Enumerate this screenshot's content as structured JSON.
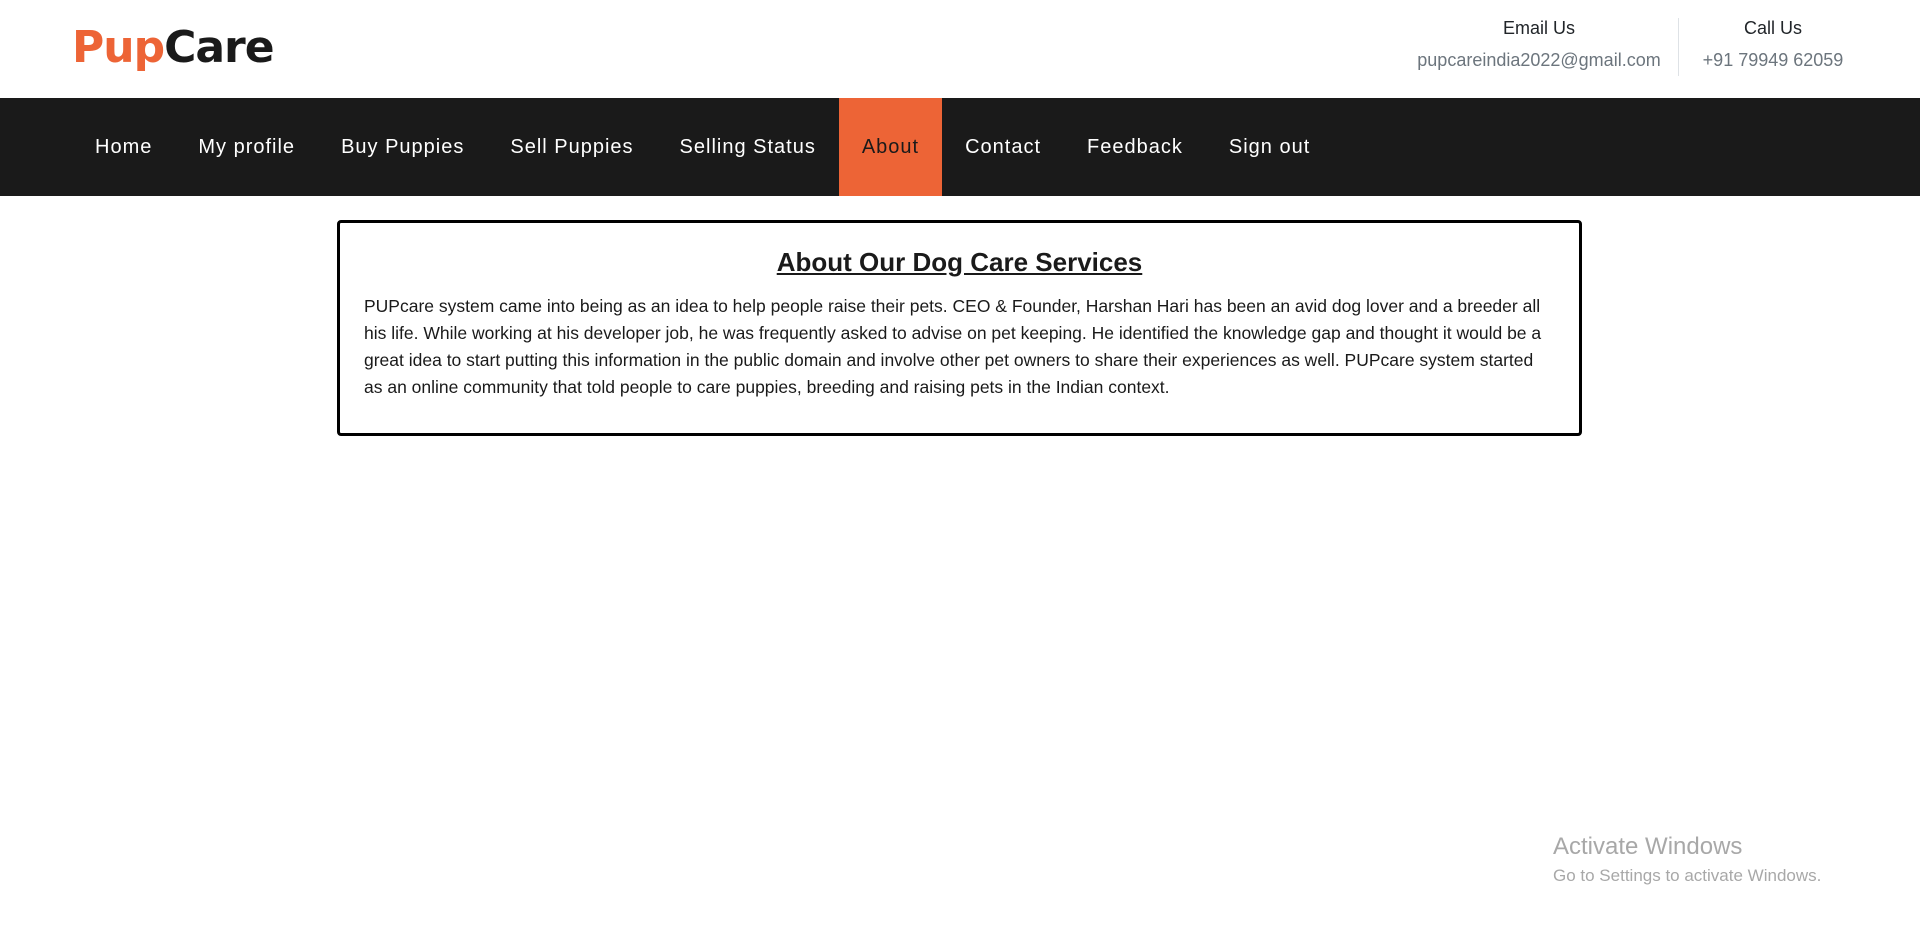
{
  "header": {
    "logo_part1": "Pup",
    "logo_part2": "Care",
    "email_label": "Email Us",
    "email_value": "pupcareindia2022@gmail.com",
    "phone_label": "Call Us",
    "phone_value": "+91 79949 62059"
  },
  "nav": {
    "items": [
      {
        "label": "Home"
      },
      {
        "label": "My profile"
      },
      {
        "label": "Buy Puppies"
      },
      {
        "label": "Sell Puppies"
      },
      {
        "label": "Selling Status"
      },
      {
        "label": "About"
      },
      {
        "label": "Contact"
      },
      {
        "label": "Feedback"
      },
      {
        "label": "Sign out"
      }
    ],
    "active_index": 5
  },
  "about": {
    "title": "About Our Dog Care Services",
    "body": "PUPcare system came into being as an idea to help people raise their pets. CEO & Founder, Harshan Hari has been an avid dog lover and a breeder all his life. While working at his developer job, he was frequently asked to advise on pet keeping. He identified the knowledge gap and thought it would be a great idea to start putting this information in the public domain and involve other pet owners to share their experiences as well. PUPcare system started as an online community that told people to care puppies, breeding and raising pets in the Indian context."
  },
  "watermark": {
    "title": "Activate Windows",
    "subtitle": "Go to Settings to activate Windows."
  },
  "colors": {
    "accent": "#ed6436",
    "navbar_bg": "#1a1a1a",
    "text_dark": "#1a1a1a",
    "text_muted": "#6c757d"
  }
}
